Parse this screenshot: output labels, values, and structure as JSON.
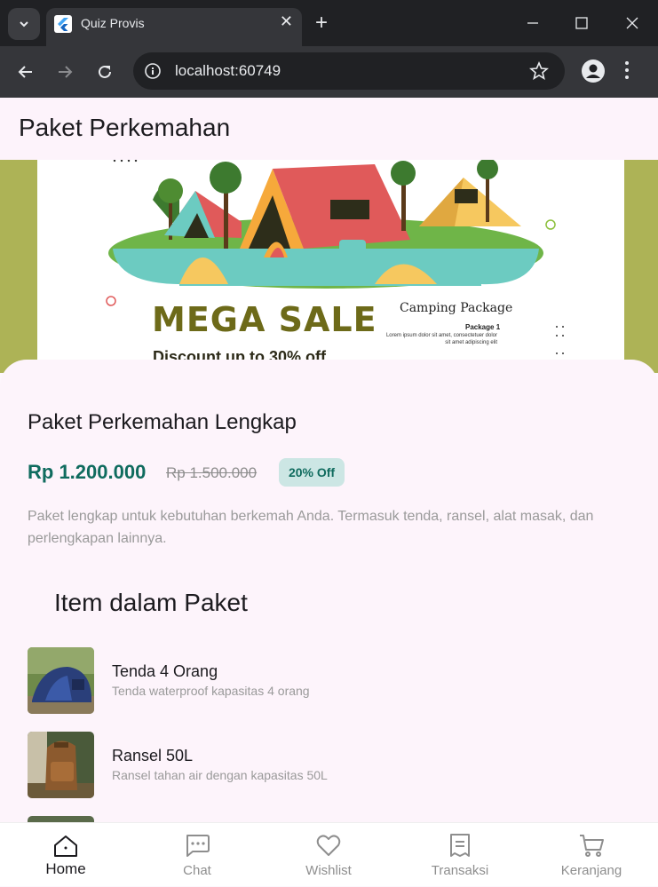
{
  "browser": {
    "tab_title": "Quiz Provis",
    "url": "localhost:60749",
    "close_glyph": "✕",
    "new_tab_glyph": "+"
  },
  "appbar": {
    "title": "Paket Perkemahan"
  },
  "banner": {
    "headline": "MEGA SALE",
    "discount": "Discount up to 30% off",
    "camping_title": "Camping Package",
    "package_label": "Package 1",
    "package_text": "Lorem ipsum dolor sit amet, consectetuer dolor sit amet adipiscing elit"
  },
  "product": {
    "title": "Paket Perkemahan Lengkap",
    "price": "Rp 1.200.000",
    "old_price": "Rp 1.500.000",
    "badge": "20% Off",
    "description": "Paket lengkap untuk kebutuhan berkemah Anda. Termasuk tenda, ransel, alat masak, dan perlengkapan lainnya."
  },
  "items_section": {
    "title": "Item dalam Paket",
    "items": [
      {
        "name": "Tenda 4 Orang",
        "desc": "Tenda waterproof kapasitas 4 orang",
        "icon": "tent-photo"
      },
      {
        "name": "Ransel 50L",
        "desc": "Ransel tahan air dengan kapasitas 50L",
        "icon": "backpack-photo"
      }
    ]
  },
  "bottom_nav": {
    "items": [
      {
        "label": "Home",
        "icon": "home-icon",
        "active": true
      },
      {
        "label": "Chat",
        "icon": "chat-icon",
        "active": false
      },
      {
        "label": "Wishlist",
        "icon": "heart-icon",
        "active": false
      },
      {
        "label": "Transaksi",
        "icon": "receipt-icon",
        "active": false
      },
      {
        "label": "Keranjang",
        "icon": "cart-icon",
        "active": false
      }
    ]
  },
  "colors": {
    "accent": "#0f6b5e",
    "banner_bg": "#adb356",
    "sheet_bg": "#fdf4fb"
  }
}
